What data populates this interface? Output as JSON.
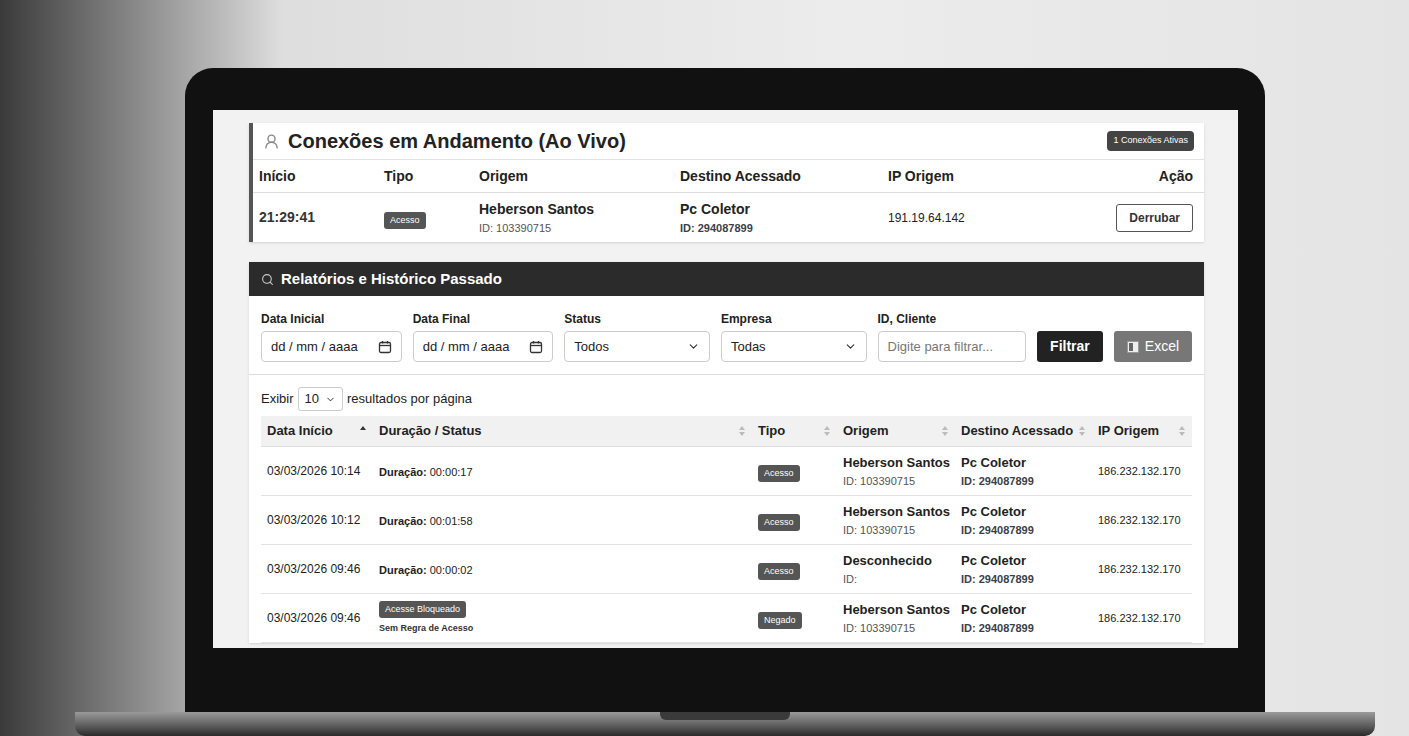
{
  "live": {
    "title": "Conexões em Andamento (Ao Vivo)",
    "badge": "1 Conexões Ativas",
    "columns": [
      "Início",
      "Tipo",
      "Origem",
      "Destino Acessado",
      "IP Origem",
      "Ação"
    ],
    "rows": [
      {
        "start": "21:29:41",
        "type": "Acesso",
        "origin_name": "Heberson Santos",
        "origin_id": "ID: 103390715",
        "dest_name": "Pc Coletor",
        "dest_id": "ID: 294087899",
        "ip": "191.19.64.142",
        "action": "Derrubar"
      }
    ]
  },
  "reports": {
    "title": "Relatórios e Histórico Passado",
    "filters": [
      {
        "label": "Data Inicial",
        "kind": "date",
        "value": "dd / mm / aaaa"
      },
      {
        "label": "Data Final",
        "kind": "date",
        "value": "dd / mm / aaaa"
      },
      {
        "label": "Status",
        "kind": "select",
        "value": "Todos"
      },
      {
        "label": "Empresa",
        "kind": "select",
        "value": "Todas"
      },
      {
        "label": "ID, Cliente",
        "kind": "text",
        "value": "Digite para filtrar..."
      }
    ],
    "buttons": [
      {
        "label": "Filtrar",
        "kind": "primary"
      },
      {
        "label": "Excel",
        "kind": "excel"
      }
    ],
    "page_size": {
      "prefix": "Exibir",
      "value": "10",
      "suffix": "resultados por página"
    },
    "columns": [
      {
        "label": "Data Início",
        "sort": "asc"
      },
      {
        "label": "Duração / Status",
        "sort": "none"
      },
      {
        "label": "Tipo",
        "sort": "none"
      },
      {
        "label": "Origem",
        "sort": "none"
      },
      {
        "label": "Destino Acessado",
        "sort": "none"
      },
      {
        "label": "IP Origem",
        "sort": "none"
      }
    ],
    "rows": [
      {
        "start": "03/03/2026 10:14",
        "kind": "duration",
        "duration_label": "Duração:",
        "duration": "00:00:17",
        "type": "Acesso",
        "origin_name": "Heberson Santos",
        "origin_id": "ID: 103390715",
        "dest_name": "Pc Coletor",
        "dest_id": "ID: 294087899",
        "ip": "186.232.132.170"
      },
      {
        "start": "03/03/2026 10:12",
        "kind": "duration",
        "duration_label": "Duração:",
        "duration": "00:01:58",
        "type": "Acesso",
        "origin_name": "Heberson Santos",
        "origin_id": "ID: 103390715",
        "dest_name": "Pc Coletor",
        "dest_id": "ID: 294087899",
        "ip": "186.232.132.170"
      },
      {
        "start": "03/03/2026 09:46",
        "kind": "duration",
        "duration_label": "Duração:",
        "duration": "00:00:02",
        "type": "Acesso",
        "origin_name": "Desconhecido",
        "origin_id": "ID:",
        "dest_name": "Pc Coletor",
        "dest_id": "ID: 294087899",
        "ip": "186.232.132.170"
      },
      {
        "start": "03/03/2026 09:46",
        "kind": "blocked",
        "status": "Acesse Bloqueado",
        "reason": "Sem Regra de Acesso",
        "type": "Negado",
        "origin_name": "Heberson Santos",
        "origin_id": "ID: 103390715",
        "dest_name": "Pc Coletor",
        "dest_id": "ID: 294087899",
        "ip": "186.232.132.170"
      }
    ]
  }
}
